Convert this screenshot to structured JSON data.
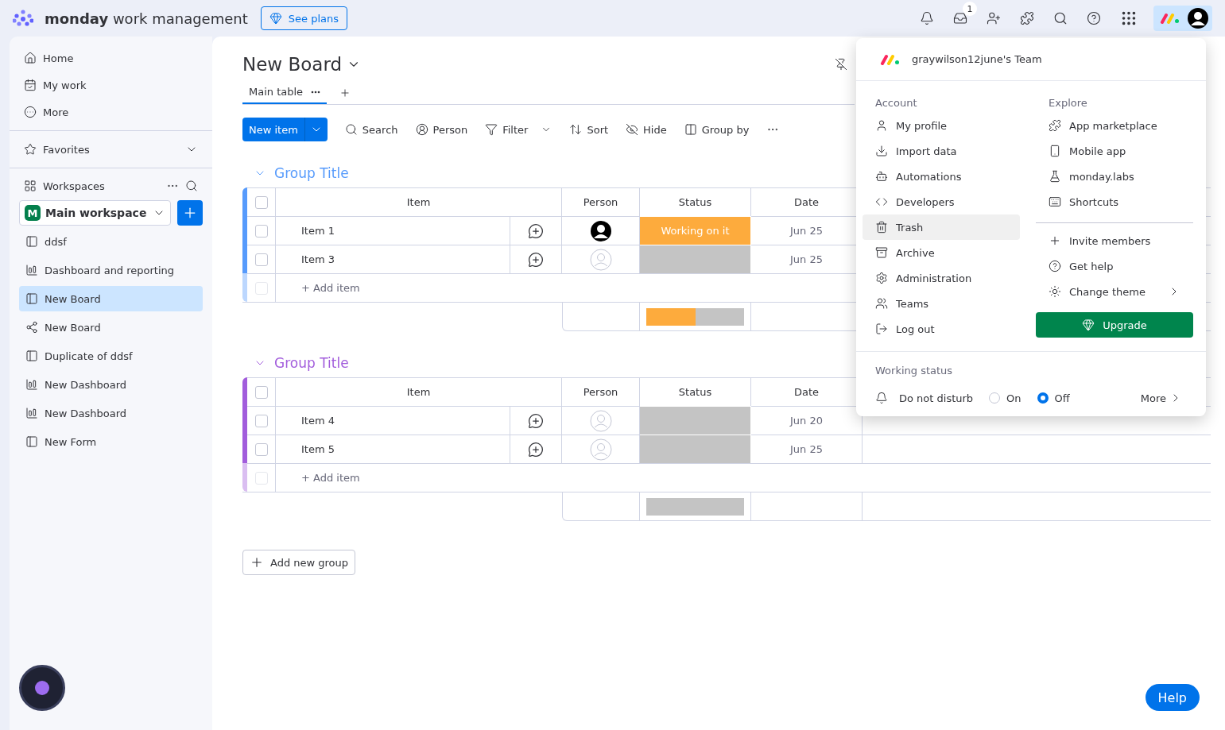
{
  "topbar": {
    "logo_bold": "monday",
    "logo_rest": "work management",
    "see_plans": "See plans",
    "inbox_badge": "1"
  },
  "sidebar": {
    "nav": [
      {
        "label": "Home",
        "kind": "home"
      },
      {
        "label": "My work",
        "kind": "mywork"
      },
      {
        "label": "More",
        "kind": "more"
      }
    ],
    "favorites": "Favorites",
    "workspaces": "Workspaces",
    "workspace": {
      "letter": "M",
      "name": "Main workspace"
    },
    "items": [
      {
        "label": "ddsf",
        "kind": "board",
        "selected": false
      },
      {
        "label": "Dashboard and reporting",
        "kind": "dashboard",
        "selected": false
      },
      {
        "label": "New Board",
        "kind": "board",
        "selected": true
      },
      {
        "label": "New Board",
        "kind": "shared",
        "selected": false
      },
      {
        "label": "Duplicate of ddsf",
        "kind": "board",
        "selected": false
      },
      {
        "label": "New Dashboard",
        "kind": "dashboard",
        "selected": false
      },
      {
        "label": "New Dashboard",
        "kind": "dashboard",
        "selected": false
      },
      {
        "label": "New Form",
        "kind": "board",
        "selected": false
      }
    ]
  },
  "board": {
    "title": "New Board",
    "views": [
      {
        "label": "Main table",
        "selected": true
      }
    ],
    "new_item": "New item",
    "tools": [
      {
        "label": "Search",
        "kind": "search"
      },
      {
        "label": "Person",
        "kind": "person"
      },
      {
        "label": "Filter",
        "kind": "filter"
      },
      {
        "label": "Sort",
        "kind": "sort"
      },
      {
        "label": "Hide",
        "kind": "hide"
      },
      {
        "label": "Group by",
        "kind": "group"
      }
    ],
    "groups": [
      {
        "title": "Group Title",
        "color": "#579bfc",
        "all_checked": false,
        "columns": [
          "Item",
          "Person",
          "Status",
          "Date"
        ],
        "rows": [
          {
            "item": "Item 1",
            "checked": false,
            "assigned": true,
            "status": {
              "label": "Working on it",
              "color": "#fdab3d"
            },
            "date": "Jun 25"
          },
          {
            "item": "Item 3",
            "checked": false,
            "assigned": false,
            "status": {
              "color": "#c4c4c4"
            },
            "date": "Jun 25"
          }
        ],
        "add_item": "+ Add item",
        "add_item_checked": false,
        "summary": [
          {
            "color": "#fdab3d",
            "level": 0.5
          },
          {
            "color": "#c4c4c4",
            "level": 0.5
          }
        ]
      },
      {
        "title": "Group Title",
        "color": "#a25ddc",
        "all_checked": false,
        "columns": [
          "Item",
          "Person",
          "Status",
          "Date"
        ],
        "rows": [
          {
            "item": "Item 4",
            "checked": false,
            "assigned": false,
            "status": {
              "color": "#c4c4c4"
            },
            "date": "Jun 20"
          },
          {
            "item": "Item 5",
            "checked": false,
            "assigned": false,
            "status": {
              "color": "#c4c4c4"
            },
            "date": "Jun 25"
          }
        ],
        "add_item": "+ Add item",
        "add_item_checked": false,
        "summary": [
          {
            "color": "#c4c4c4",
            "level": 1
          }
        ]
      }
    ],
    "add_group": "Add new group"
  },
  "menu": {
    "team": "graywilson12june's Team",
    "account_heading": "Account",
    "account_items": [
      {
        "label": "My profile",
        "kind": "profile",
        "selected": false
      },
      {
        "label": "Import data",
        "kind": "import",
        "selected": false
      },
      {
        "label": "Automations",
        "kind": "automations",
        "selected": false
      },
      {
        "label": "Developers",
        "kind": "developers",
        "selected": false
      },
      {
        "label": "Trash",
        "kind": "trash",
        "selected": true
      },
      {
        "label": "Archive",
        "kind": "archive",
        "selected": false
      },
      {
        "label": "Administration",
        "kind": "admin",
        "selected": false
      },
      {
        "label": "Teams",
        "kind": "teams",
        "selected": false
      },
      {
        "label": "Log out",
        "kind": "logout",
        "selected": false
      }
    ],
    "explore_heading": "Explore",
    "explore_items": [
      {
        "label": "App marketplace",
        "kind": "marketplace"
      },
      {
        "label": "Mobile app",
        "kind": "mobile"
      },
      {
        "label": "monday.labs",
        "kind": "labs"
      },
      {
        "label": "Shortcuts",
        "kind": "shortcuts"
      }
    ],
    "extra_items": [
      {
        "label": "Invite members",
        "kind": "invite",
        "submenu": false
      },
      {
        "label": "Get help",
        "kind": "help",
        "submenu": false
      },
      {
        "label": "Change theme",
        "kind": "theme",
        "submenu": true
      }
    ],
    "upgrade": "Upgrade",
    "working_status": "Working status",
    "dnd": "Do not disturb",
    "options": [
      {
        "label": "On",
        "selected": false
      },
      {
        "label": "Off",
        "selected": true
      }
    ],
    "more": "More"
  },
  "help": "Help"
}
